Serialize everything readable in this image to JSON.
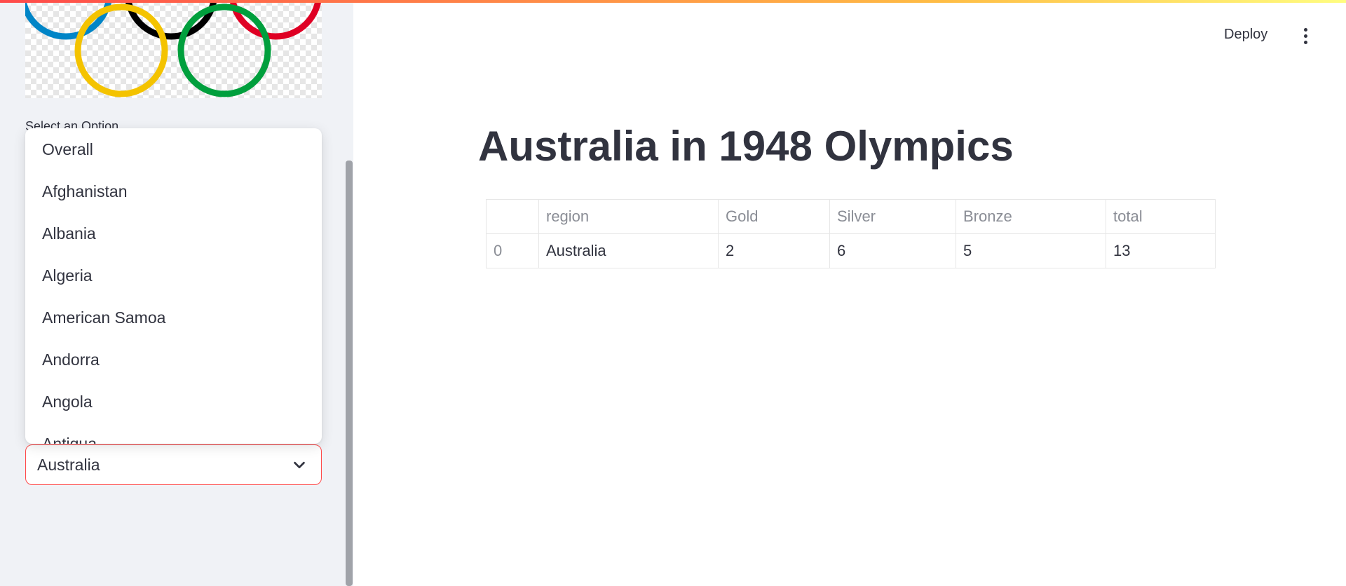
{
  "sidebar": {
    "select_label": "Select an Option",
    "options": [
      "Overall",
      "Afghanistan",
      "Albania",
      "Algeria",
      "American Samoa",
      "Andorra",
      "Angola",
      "Antigua"
    ],
    "selected_value": "Australia"
  },
  "header": {
    "deploy_label": "Deploy"
  },
  "main": {
    "title": "Australia in 1948 Olympics",
    "table": {
      "columns": [
        "",
        "region",
        "Gold",
        "Silver",
        "Bronze",
        "total"
      ],
      "rows": [
        [
          "0",
          "Australia",
          "2",
          "6",
          "5",
          "13"
        ]
      ]
    }
  },
  "colors": {
    "accent": "#ff4b4b",
    "sidebar_bg": "#f0f2f6",
    "text": "#31333f",
    "ring_blue": "#0085c7",
    "ring_yellow": "#f4c300",
    "ring_black": "#000000",
    "ring_green": "#009f3d",
    "ring_red": "#df0024"
  },
  "icons": {
    "select_chevron": "chevron-down-icon",
    "main_menu": "kebab-menu-icon",
    "logo": "olympic-rings-logo"
  }
}
